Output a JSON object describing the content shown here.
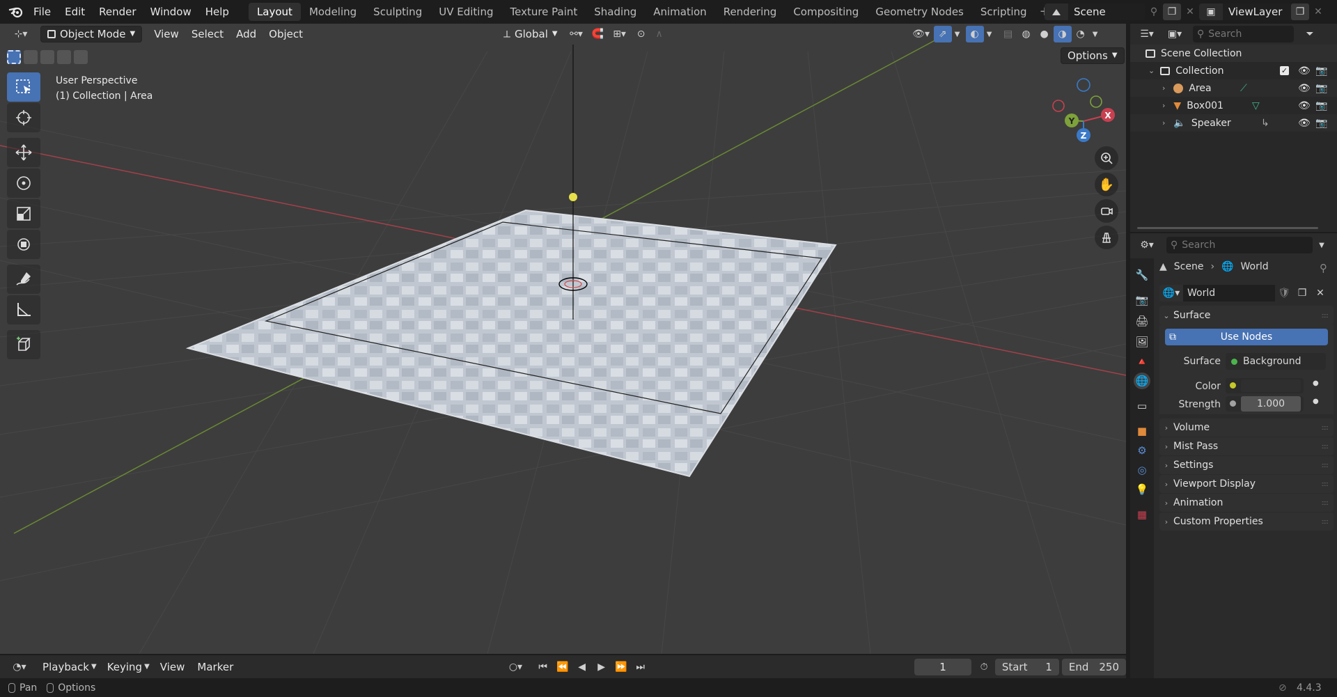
{
  "topbar": {
    "menu": [
      "File",
      "Edit",
      "Render",
      "Window",
      "Help"
    ],
    "workspaces": [
      "Layout",
      "Modeling",
      "Sculpting",
      "UV Editing",
      "Texture Paint",
      "Shading",
      "Animation",
      "Rendering",
      "Compositing",
      "Geometry Nodes",
      "Scripting"
    ],
    "active_workspace": "Layout",
    "add_workspace": "+",
    "scene_name": "Scene",
    "view_layer": "ViewLayer"
  },
  "viewport": {
    "mode": "Object Mode",
    "menus": [
      "View",
      "Select",
      "Add",
      "Object"
    ],
    "transform_orientation": "Global",
    "options_label": "Options",
    "info_line1": "User Perspective",
    "info_line2": "(1) Collection | Area",
    "gizmo_axes": {
      "x": "X",
      "y": "Y",
      "z": "Z"
    }
  },
  "outliner": {
    "search_placeholder": "Search",
    "scene_collection": "Scene Collection",
    "collection": "Collection",
    "items": [
      {
        "name": "Area",
        "type": "light"
      },
      {
        "name": "Box001",
        "type": "mesh"
      },
      {
        "name": "Speaker",
        "type": "speaker"
      }
    ]
  },
  "properties": {
    "search_placeholder": "Search",
    "breadcrumb_scene": "Scene",
    "breadcrumb_world": "World",
    "world_name": "World",
    "surface_panel": "Surface",
    "use_nodes": "Use Nodes",
    "surface_label": "Surface",
    "surface_value": "Background",
    "color_label": "Color",
    "strength_label": "Strength",
    "strength_value": "1.000",
    "panels": [
      "Volume",
      "Mist Pass",
      "Settings",
      "Viewport Display",
      "Animation",
      "Custom Properties"
    ]
  },
  "timeline": {
    "menus": [
      "Playback",
      "Keying",
      "View",
      "Marker"
    ],
    "current_frame": "1",
    "start_label": "Start",
    "start_value": "1",
    "end_label": "End",
    "end_value": "250"
  },
  "statusbar": {
    "pan": "Pan",
    "options": "Options",
    "version": "4.4.3"
  },
  "colors": {
    "accent": "#4772b3",
    "viewport_bg": "#3d3d3d",
    "x_axis": "#c84050",
    "y_axis": "#7da23a",
    "z_axis": "#3a7ac8"
  }
}
